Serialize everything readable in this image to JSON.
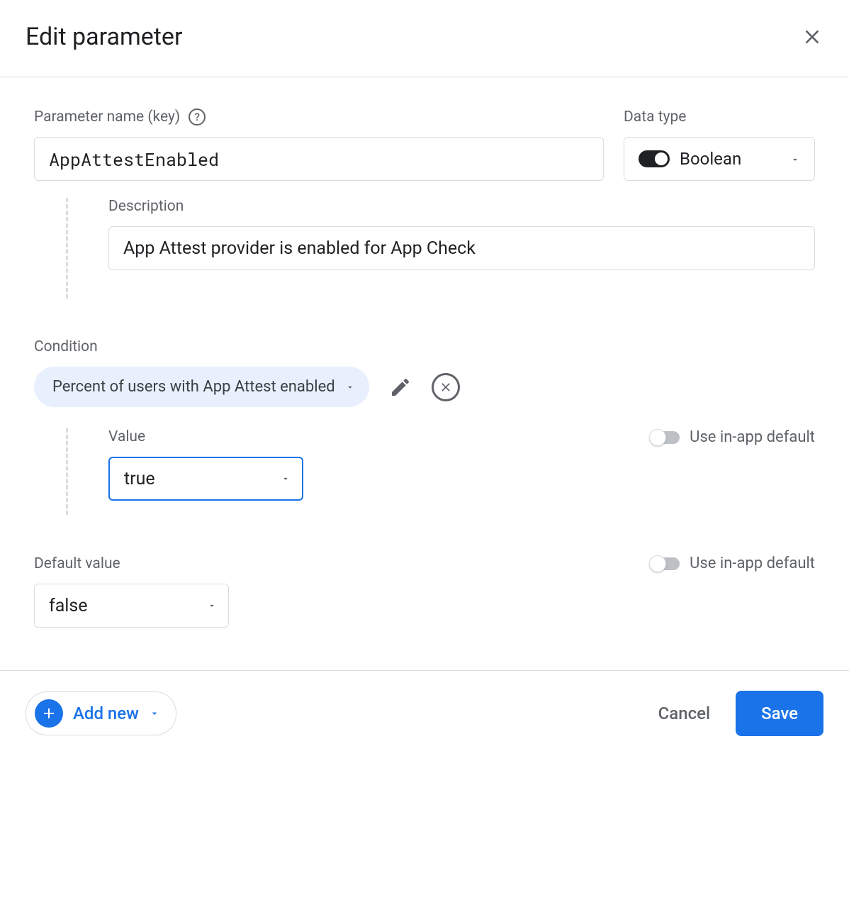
{
  "header": {
    "title": "Edit parameter"
  },
  "param": {
    "name_label": "Parameter name (key)",
    "name_value": "AppAttestEnabled",
    "data_type_label": "Data type",
    "data_type_value": "Boolean"
  },
  "description": {
    "label": "Description",
    "value": "App Attest provider is enabled for App Check"
  },
  "condition": {
    "label": "Condition",
    "chip_label": "Percent of users with App Attest enabled",
    "value_label": "Value",
    "value": "true",
    "use_inapp_label": "Use in-app default"
  },
  "default": {
    "label": "Default value",
    "value": "false",
    "use_inapp_label": "Use in-app default"
  },
  "footer": {
    "add_new": "Add new",
    "cancel": "Cancel",
    "save": "Save"
  }
}
